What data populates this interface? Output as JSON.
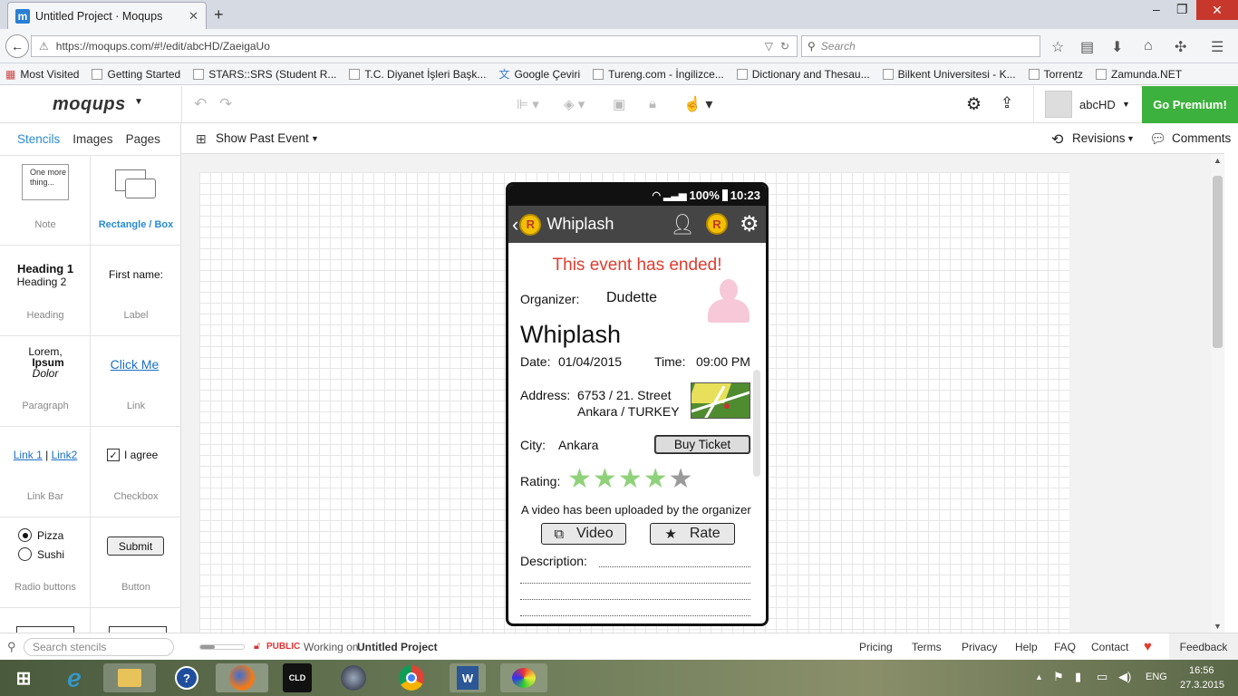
{
  "browser": {
    "tab_title": "Untitled Project · Moqups",
    "tab_logo": "m",
    "url": "https://moqups.com/#!/edit/abcHD/ZaeigaUo",
    "search_placeholder": "Search",
    "bookmarks": [
      "Most Visited",
      "Getting Started",
      "STARS::SRS (Student R...",
      "T.C. Diyanet İşleri Başk...",
      "Google Çeviri",
      "Tureng.com - İngilizce...",
      "Dictionary and Thesau...",
      "Bilkent Universitesi - K...",
      "Torrentz",
      "Zamunda.NET"
    ]
  },
  "app": {
    "logo": "moqups",
    "user": "abcHD",
    "premium_label": "Go Premium!",
    "page_selector": "Show Past Event",
    "revisions_label": "Revisions",
    "comments_label": "Comments"
  },
  "left_panel": {
    "tabs": [
      "Stencils",
      "Images",
      "Pages"
    ],
    "note_text": "One more thing...",
    "stencils": {
      "note": "Note",
      "rect": "Rectangle / Box",
      "heading": "Heading",
      "heading1": "Heading 1",
      "heading2": "Heading 2",
      "label": "Label",
      "label_text": "First name:",
      "paragraph": "Paragraph",
      "para1": "Lorem,",
      "para2": "Ipsum",
      "para3": "Dolor",
      "link": "Link",
      "link_text": "Click Me",
      "linkbar": "Link Bar",
      "link1": "Link 1",
      "link2": "Link2",
      "checkbox": "Checkbox",
      "checkbox_text": "I agree",
      "radio": "Radio buttons",
      "radio1": "Pizza",
      "radio2": "Sushi",
      "button": "Button",
      "button_text": "Submit"
    },
    "search_placeholder": "Search stencils"
  },
  "phone": {
    "battery": "100%",
    "time": "10:23",
    "title": "Whiplash",
    "badge": "R",
    "ended": "This event has ended!",
    "organizer_label": "Organizer:",
    "organizer": "Dudette",
    "event_name": "Whiplash",
    "date_label": "Date:",
    "date": "01/04/2015",
    "time_label": "Time:",
    "event_time": "09:00 PM",
    "address_label": "Address:",
    "address1": "6753 / 21. Street",
    "address2": "Ankara / TURKEY",
    "city_label": "City:",
    "city": "Ankara",
    "buy_ticket": "Buy Ticket",
    "rating_label": "Rating:",
    "rating": 4,
    "rating_max": 5,
    "video_note": "A video has been uploaded by the organizer",
    "video_btn": "Video",
    "rate_btn": "Rate",
    "description_label": "Description:"
  },
  "statusbar": {
    "public": "PUBLIC",
    "working_on": "Working on",
    "project": "Untitled Project",
    "links": [
      "Pricing",
      "Terms",
      "Privacy",
      "Help",
      "FAQ",
      "Contact"
    ],
    "feedback": "Feedback"
  },
  "taskbar": {
    "lang": "ENG",
    "clock_time": "16:56",
    "clock_date": "27.3.2015"
  },
  "colors": {
    "accent": "#2a8bd0",
    "premium": "#3db13d",
    "ended": "#e03c2e",
    "star_on": "#8fd27a",
    "star_off": "#9a9a9a"
  }
}
